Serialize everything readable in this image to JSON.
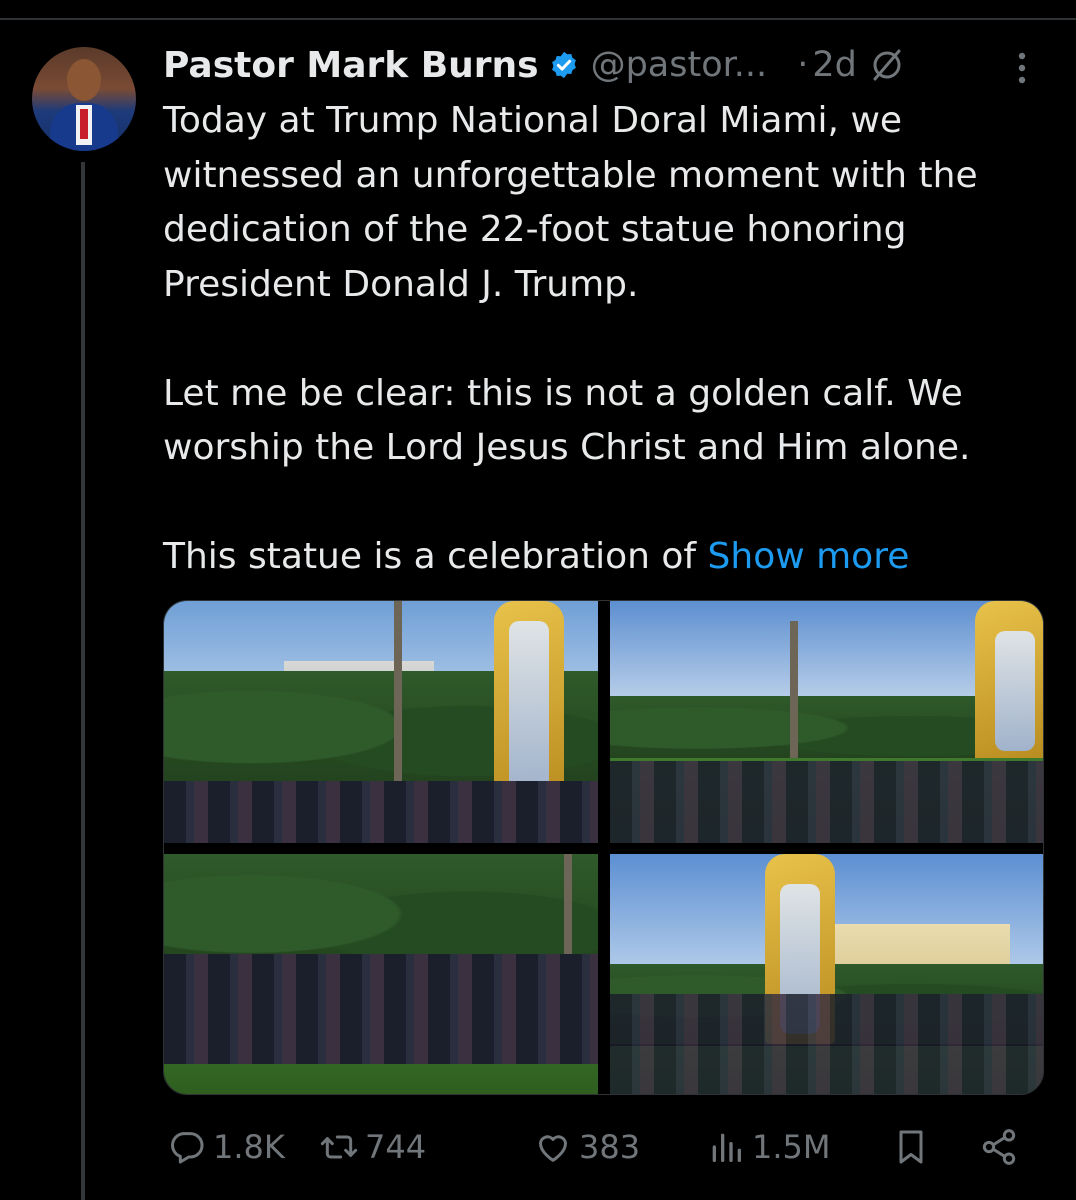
{
  "author": {
    "name": "Pastor Mark Burns",
    "handle": "@pastor...",
    "separator": "·",
    "age": "2d"
  },
  "icons": {
    "verified": "verified-badge-icon",
    "grok": "grok-icon",
    "more": "more-options-icon"
  },
  "tweet": {
    "paragraph_1": "Today at Trump National Doral Miami, we witnessed an unforgettable moment with the dedication of the 22-foot statue honoring President Donald J. Trump.",
    "paragraph_2": "Let me be clear: this is not a golden calf. We worship the Lord Jesus Christ and Him alone.",
    "paragraph_3": "This statue is a celebration of ",
    "show_more": "Show more"
  },
  "actions": {
    "replies": "1.8K",
    "reposts": "744",
    "likes": "383",
    "views": "1.5M"
  },
  "colors": {
    "background": "#000000",
    "text": "#e7e9ea",
    "secondary": "#71767b",
    "link": "#1d9bf0",
    "verified": "#1d9bf0"
  }
}
